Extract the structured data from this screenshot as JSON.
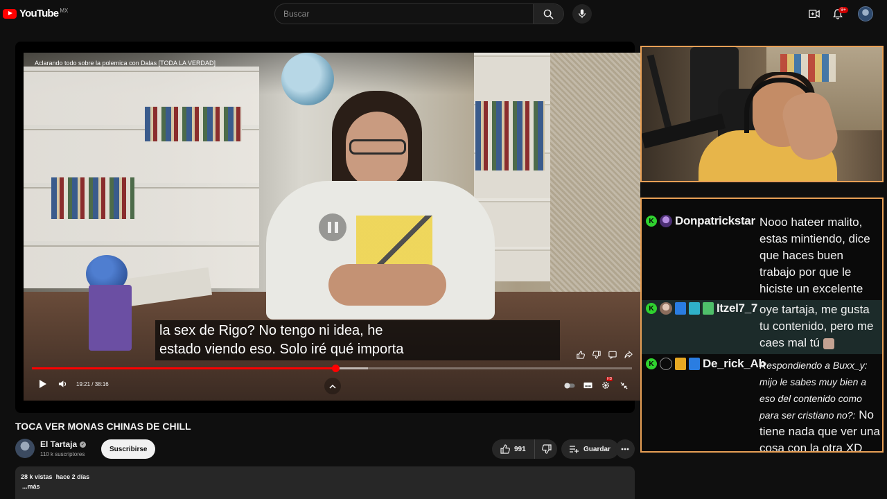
{
  "header": {
    "logo_text": "YouTube",
    "logo_region": "MX",
    "search_placeholder": "Buscar",
    "notification_count": "9+"
  },
  "player": {
    "overlay_title": "Aclarando todo sobre la polemica con Dalas [TODA LA VERDAD]",
    "caption_line1": "la sex de Rigo? No tengo ni idea, he",
    "caption_line2": "estado viendo eso. Solo iré qué importa",
    "time_current": "19:21",
    "time_separator": "/",
    "time_total": "38:16",
    "progress_fraction": 0.506,
    "colors": {
      "played": "#ff0000",
      "accent_border": "#e8a056"
    }
  },
  "video": {
    "title": "TOCA VER MONAS CHINAS DE CHILL",
    "channel_name": "El Tartaja",
    "subscribers": "110 k suscriptores",
    "subscribe_label": "Suscribirse",
    "likes": "991",
    "save_label": "Guardar",
    "views": "28 k vistas",
    "uploaded": "hace 2 días",
    "more_label": "...más"
  },
  "chat": {
    "messages": [
      {
        "username": "Donpatrickstar",
        "text": "Nooo hateer malito, estas mintiendo, dice que haces buen trabajo por que le hiciste un excelente wawis"
      },
      {
        "username": "Itzel7_7",
        "text": "oye tartaja, me gusta tu contenido, pero me caes mal tú"
      },
      {
        "username": "De_rick_Ab",
        "reply_text": "Respondiendo a Buxx_y: mijo le sabes muy bien a eso del contenido como para ser cristiano no?:",
        "text": "No tiene nada que ver una cosa con la otra XD"
      }
    ]
  }
}
